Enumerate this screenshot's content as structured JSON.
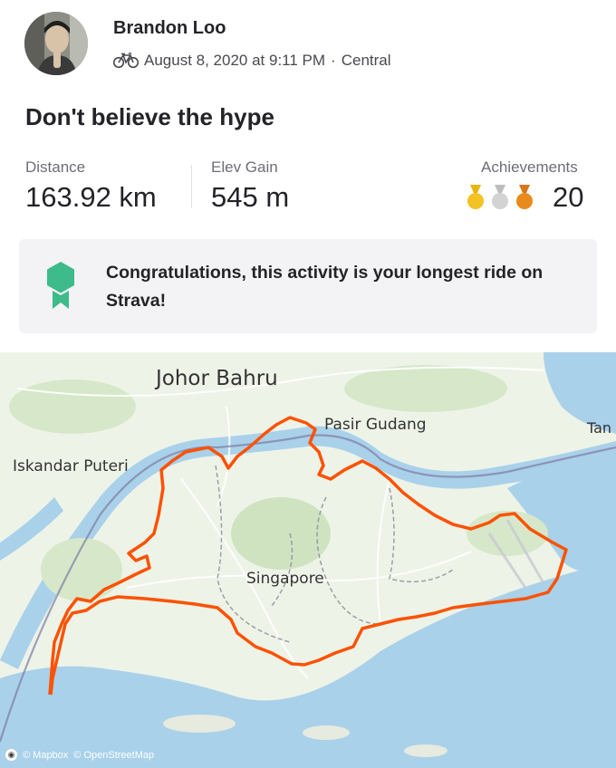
{
  "header": {
    "athlete_name": "Brandon Loo",
    "activity_icon": "bicycle-icon",
    "date_time": "August 8, 2020 at 9:11 PM",
    "separator": "·",
    "location": "Central"
  },
  "activity": {
    "title": "Don't believe the hype"
  },
  "stats": {
    "distance_label": "Distance",
    "distance_value": "163.92 km",
    "elev_label": "Elev Gain",
    "elev_value": "545 m",
    "achievements_label": "Achievements",
    "achievements_count": "20",
    "medal_icons": [
      "gold-medal-icon",
      "silver-medal-icon",
      "bronze-medal-icon"
    ]
  },
  "banner": {
    "icon": "longest-ride-badge-icon",
    "text": "Congratulations, this activity is your longest ride on Strava!",
    "badge_color": "#3dbb8a"
  },
  "map": {
    "labels": {
      "johor_bahru": "Johor Bahru",
      "pasir_gudang": "Pasir Gudang",
      "iskandar_puteri": "Iskandar Puteri",
      "singapore": "Singapore",
      "tan": "Tan"
    },
    "attribution": {
      "mapbox": "© Mapbox",
      "osm": "© OpenStreetMap"
    },
    "route_color": "#fc5200",
    "water_color": "#a9d1ea",
    "land_color": "#eef3e8"
  }
}
